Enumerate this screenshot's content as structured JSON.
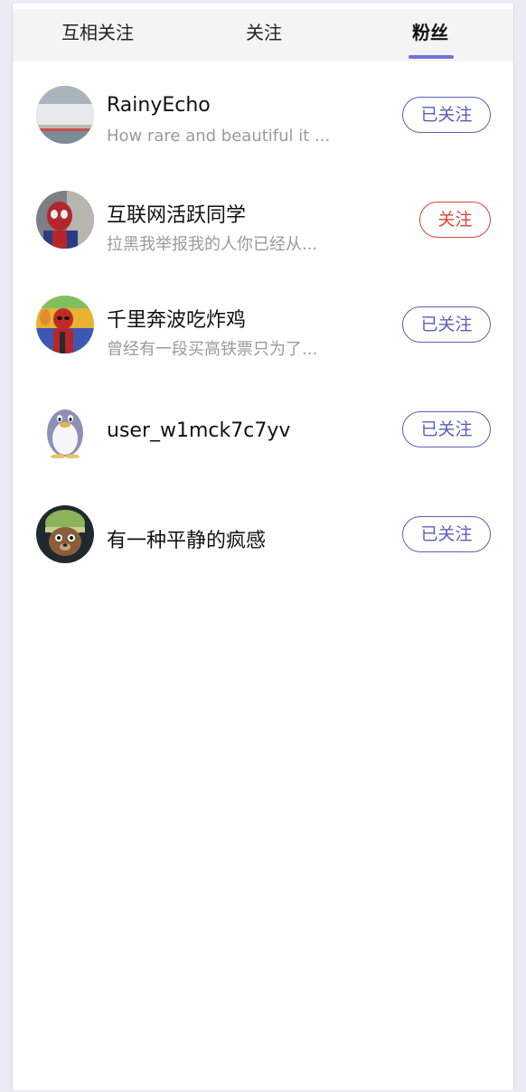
{
  "tabs": [
    {
      "label": "互相关注"
    },
    {
      "label": "关注"
    },
    {
      "label": "粉丝"
    }
  ],
  "active_tab": "粉丝",
  "accent_color": "#6f73d8",
  "users": [
    {
      "name": "RainyEcho",
      "bio": "How rare and beautiful it ...",
      "button": "已关注",
      "avatar_icon": "landscape-photo-icon"
    },
    {
      "name": "互联网活跃同学",
      "bio": "拉黑我举报我的人你已经从...",
      "button": "关注",
      "avatar_icon": "spiderman-photo-icon"
    },
    {
      "name": "千里奔波吃炸鸡",
      "bio": "曾经有一段买高铁票只为了...",
      "button": "已关注",
      "avatar_icon": "deadpool-photo-icon"
    },
    {
      "name": "user_w1mck7c7yv",
      "bio": "",
      "button": "已关注",
      "avatar_icon": "penguin-icon"
    },
    {
      "name": "有一种平静的疯感",
      "bio": "",
      "button": "已关注",
      "avatar_icon": "bear-photo-icon"
    }
  ]
}
